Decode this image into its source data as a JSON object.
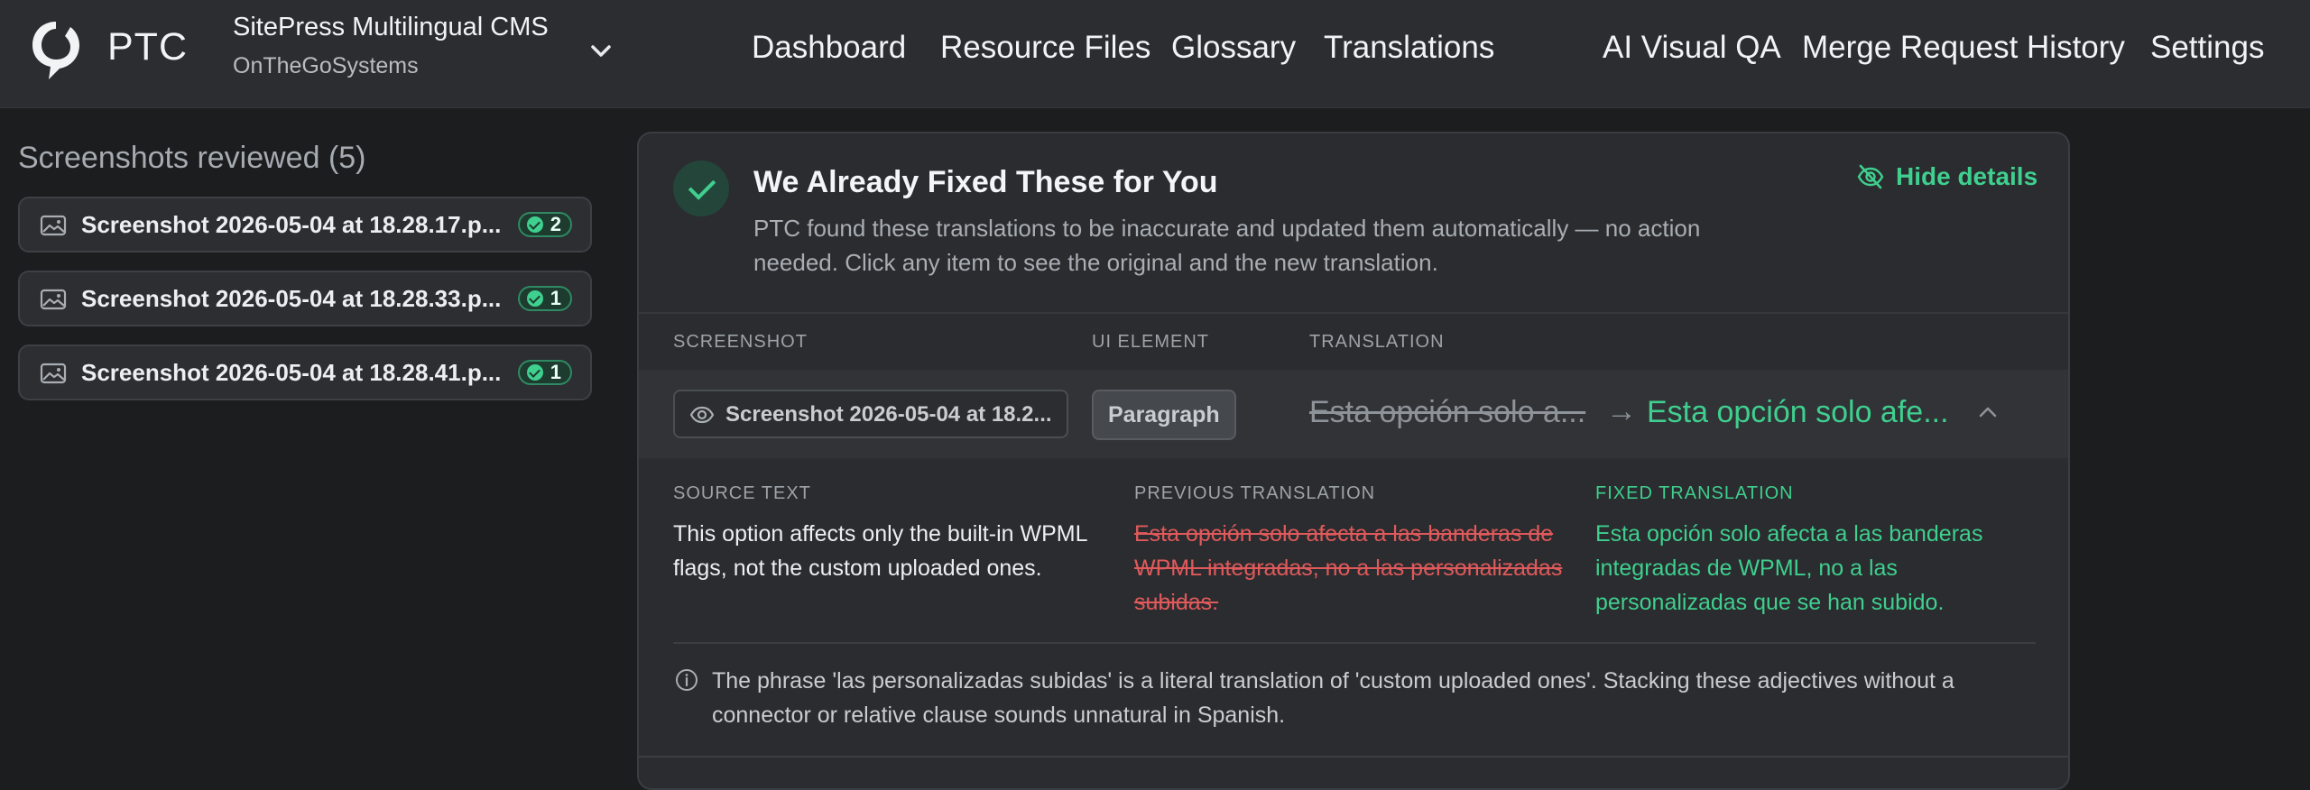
{
  "header": {
    "brand": "PTC",
    "project_name": "SitePress Multilingual CMS",
    "org_name": "OnTheGoSystems",
    "nav": [
      "Dashboard",
      "Resource Files",
      "Glossary",
      "Translations"
    ],
    "nav_right": [
      "AI Visual QA",
      "Merge Request History",
      "Settings"
    ]
  },
  "sidebar": {
    "title": "Screenshots reviewed (5)",
    "items": [
      {
        "name": "Screenshot 2026-05-04 at 18.28.17.p...",
        "count": "2"
      },
      {
        "name": "Screenshot 2026-05-04 at 18.28.33.p...",
        "count": "1"
      },
      {
        "name": "Screenshot 2026-05-04 at 18.28.41.p...",
        "count": "1"
      }
    ]
  },
  "panel": {
    "title": "We Already Fixed These for You",
    "description": "PTC found these translations to be inaccurate and updated them automatically — no action needed. Click any item to see the original and the new translation.",
    "hide_label": "Hide details",
    "columns": [
      "SCREENSHOT",
      "UI ELEMENT",
      "TRANSLATION"
    ],
    "row": {
      "screenshot": "Screenshot 2026-05-04 at 18.2...",
      "element": "Paragraph",
      "old_short": "Esta opción solo a...",
      "new_short": "Esta opción solo afe..."
    },
    "details": {
      "source_label": "SOURCE TEXT",
      "source_text": "This option affects only the built-in WPML flags, not the custom uploaded ones.",
      "previous_label": "PREVIOUS TRANSLATION",
      "previous_text": "Esta opción solo afecta a las banderas de WPML integradas, no a las personalizadas subidas.",
      "fixed_label": "FIXED TRANSLATION",
      "fixed_text": "Esta opción solo afecta a las banderas integradas de WPML, no a las personalizadas que se han subido.",
      "note": "The phrase 'las personalizadas subidas' is a literal translation of 'custom uploaded ones'. Stacking these adjectives without a connector or relative clause sounds unnatural in Spanish."
    }
  },
  "colors": {
    "accent": "#3fcf8e",
    "danger": "#e0595b",
    "bg": "#1b1d1e",
    "header": "#2b2d30"
  }
}
